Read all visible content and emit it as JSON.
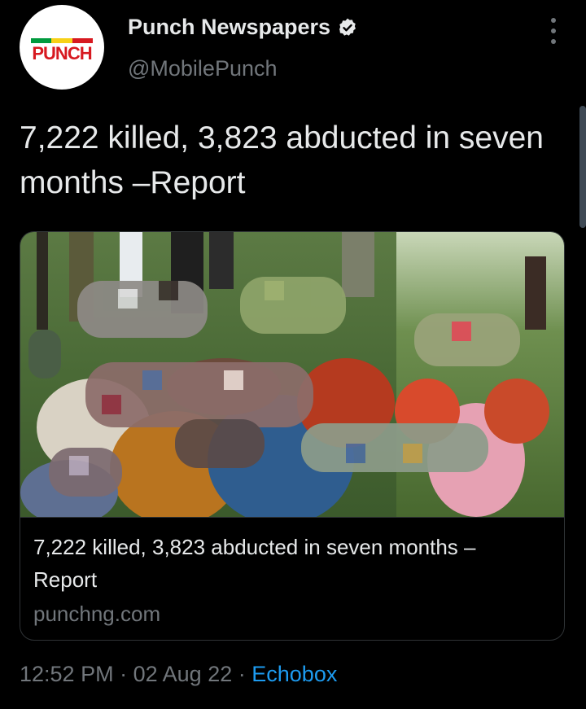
{
  "account": {
    "avatar_logo_text": "PUNCH",
    "display_name": "Punch Newspapers",
    "handle": "@MobilePunch",
    "verified": true
  },
  "tweet": {
    "text": "7,222 killed, 3,823 abducted in seven months –Report"
  },
  "link_card": {
    "title": "7,222 killed, 3,823 abducted in seven months –Report",
    "domain": "punchng.com"
  },
  "meta": {
    "time": "12:52 PM",
    "separator": "·",
    "date": "02 Aug 22",
    "source": "Echobox"
  },
  "colors": {
    "background": "#000000",
    "text_primary": "#e7e9ea",
    "text_secondary": "#71767b",
    "link": "#1d9bf0",
    "border": "#2f3336",
    "logo_red": "#d71920"
  },
  "icons": {
    "verified": "verified-badge-icon",
    "more": "more-options-icon"
  }
}
